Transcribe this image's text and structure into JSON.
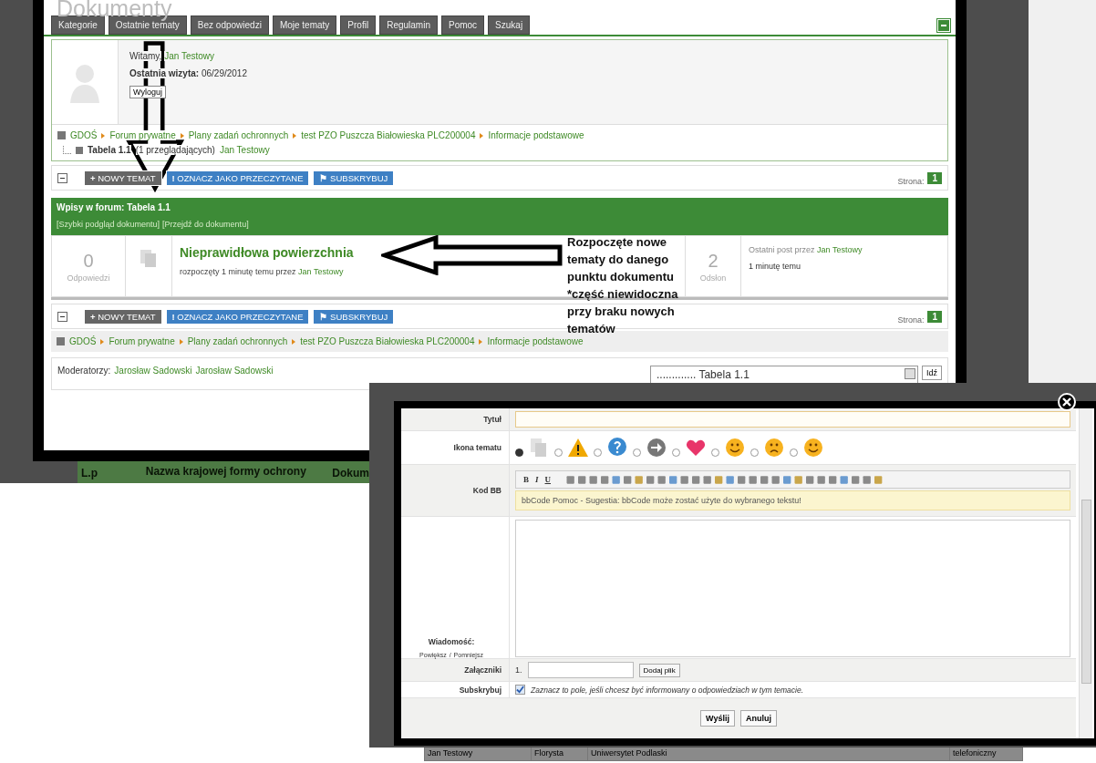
{
  "page_heading": "Dokumenty",
  "forum": {
    "tabs": [
      {
        "label": "Kategorie",
        "selected": false
      },
      {
        "label": "Ostatnie tematy",
        "selected": false
      },
      {
        "label": "Bez odpowiedzi",
        "selected": false
      },
      {
        "label": "Moje tematy",
        "selected": false
      },
      {
        "label": "Profil",
        "selected": false
      },
      {
        "label": "Regulamin",
        "selected": false
      },
      {
        "label": "Pomoc",
        "selected": false
      },
      {
        "label": "Szukaj",
        "selected": false
      }
    ],
    "user": {
      "greeting": "Witamy,",
      "name": "Jan Testowy",
      "last_visit_label": "Ostatnia wizyta:",
      "last_visit": "06/29/2012",
      "logout": "Wyloguj"
    },
    "breadcrumb": [
      "GDOŚ",
      "Forum prywatne",
      "Plany zadań ochronnych",
      "test PZO Puszcza Białowieska PLC200004",
      "Informacje podstawowe"
    ],
    "subforum": {
      "title": "Tabela 1.1",
      "viewers": "(1 przeglądających)",
      "user": "Jan Testowy"
    },
    "toolbar_top": {
      "buttons": [
        {
          "kind": "new",
          "icon": "+",
          "label": "NOWY TEMAT"
        },
        {
          "kind": "mark",
          "icon": "!",
          "label": "OZNACZ JAKO PRZECZYTANE"
        },
        {
          "kind": "subscribe",
          "icon": "⚑",
          "label": "SUBSKRYBUJ"
        }
      ],
      "page_label": "Strona:",
      "page": "1"
    },
    "topics_header": {
      "title": "Wpisy w forum: Tabela 1.1",
      "links": [
        "[Szybki podgląd dokumentu]",
        "[Przejdź do dokumentu]"
      ]
    },
    "topics": [
      {
        "replies": "0",
        "replies_label": "Odpowiedzi",
        "title": "Nieprawidłowa powierzchnia",
        "started": "rozpoczęty 1 minutę temu przez",
        "author": "Jan Testowy",
        "views": "2",
        "views_label": "Odsłon",
        "last_post_label": "Ostatni post przez",
        "last_post_author": "Jan Testowy",
        "last_post_time": "1 minutę temu"
      }
    ],
    "toolbar_bottom": {
      "buttons": [
        {
          "kind": "new",
          "icon": "+",
          "label": "NOWY TEMAT"
        },
        {
          "kind": "mark",
          "icon": "!",
          "label": "OZNACZ JAKO PRZECZYTANE"
        },
        {
          "kind": "subscribe",
          "icon": "⚑",
          "label": "SUBSKRYBUJ"
        }
      ],
      "page_label": "Strona:",
      "page": "1"
    },
    "breadcrumb_bottom": [
      "GDOŚ",
      "Forum prywatne",
      "Plany zadań ochronnych",
      "test PZO Puszcza Białowieska PLC200004",
      "Informacje podstawowe"
    ],
    "moderators": {
      "label": "Moderatorzy:",
      "names": [
        "Jarosław Sadowski",
        "Jarosław Sadowski"
      ]
    },
    "jump": {
      "value": "............. Tabela 1.1",
      "button": "Idź"
    }
  },
  "annotation": "Rozpoczęte nowe tematy do danego punktu dokumentu *część niewidoczna przy braku nowych tematów",
  "background_table": {
    "columns": [
      "L.p",
      "Nazwa krajowej formy ochrony",
      "Dokum"
    ],
    "row": [
      "Jan Testowy",
      "Florysta",
      "Uniwersytet Podlaski",
      "telefoniczny"
    ]
  },
  "modal": {
    "title_label": "Tytuł",
    "icon_label": "Ikona tematu",
    "topic_icons": [
      {
        "kind": "document",
        "selected": true
      },
      {
        "kind": "warning",
        "selected": false
      },
      {
        "kind": "question",
        "selected": false
      },
      {
        "kind": "arrow",
        "selected": false
      },
      {
        "kind": "heart",
        "selected": false
      },
      {
        "kind": "wink",
        "selected": false
      },
      {
        "kind": "sad",
        "selected": false
      },
      {
        "kind": "smile",
        "selected": false
      }
    ],
    "bbcode_label": "Kod BB",
    "bbcode_letters": [
      "B",
      "I",
      "U"
    ],
    "bbcode_hint": "bbCode Pomoc - Sugestia: bbCode może zostać użyte do wybranego tekstu!",
    "message_label": "Wiadomość:",
    "resize_links": [
      "Powiększ",
      "Pomniejsz"
    ],
    "resize_separator": "/",
    "attachments_label": "Załączniki",
    "attachment_number": "1.",
    "add_file": "Dodaj plik",
    "subscribe_label": "Subskrybuj",
    "subscribe": {
      "checked": true,
      "text": "Zaznacz to pole, jeśli chcesz być informowany o odpowiedziach w tym temacie."
    },
    "buttons": [
      "Wyślij",
      "Anuluj"
    ]
  }
}
